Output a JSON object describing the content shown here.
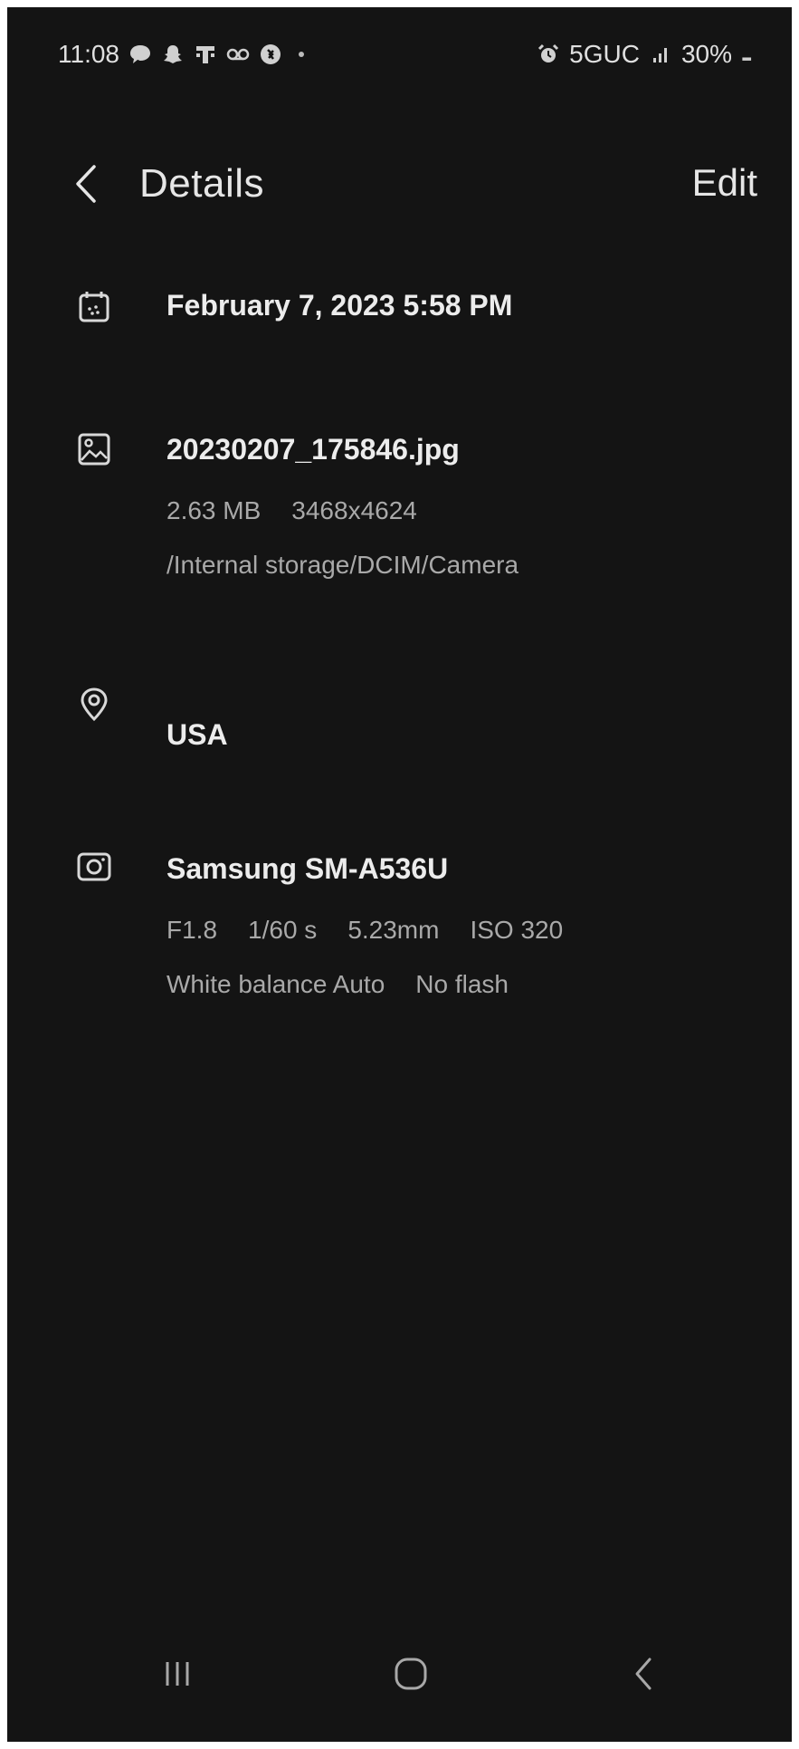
{
  "status_bar": {
    "time": "11:08",
    "network": "5GUC",
    "battery": "30%"
  },
  "header": {
    "title": "Details",
    "edit_label": "Edit"
  },
  "date": {
    "icon": "calendar-icon",
    "value": "February 7, 2023 5:58 PM"
  },
  "file": {
    "icon": "image-icon",
    "name": "20230207_175846.jpg",
    "size": "2.63 MB",
    "resolution": "3468x4624",
    "path": "/Internal storage/DCIM/Camera"
  },
  "location": {
    "icon": "location-pin-icon",
    "value": "USA"
  },
  "camera": {
    "icon": "camera-icon",
    "model": "Samsung SM-A536U",
    "aperture": "F1.8",
    "shutter": "1/60 s",
    "focal_length": "5.23mm",
    "iso": "ISO 320",
    "white_balance": "White balance Auto",
    "flash": "No flash"
  },
  "nav": {
    "recents_icon": "recents-icon",
    "home_icon": "home-icon",
    "back_icon": "back-icon"
  }
}
